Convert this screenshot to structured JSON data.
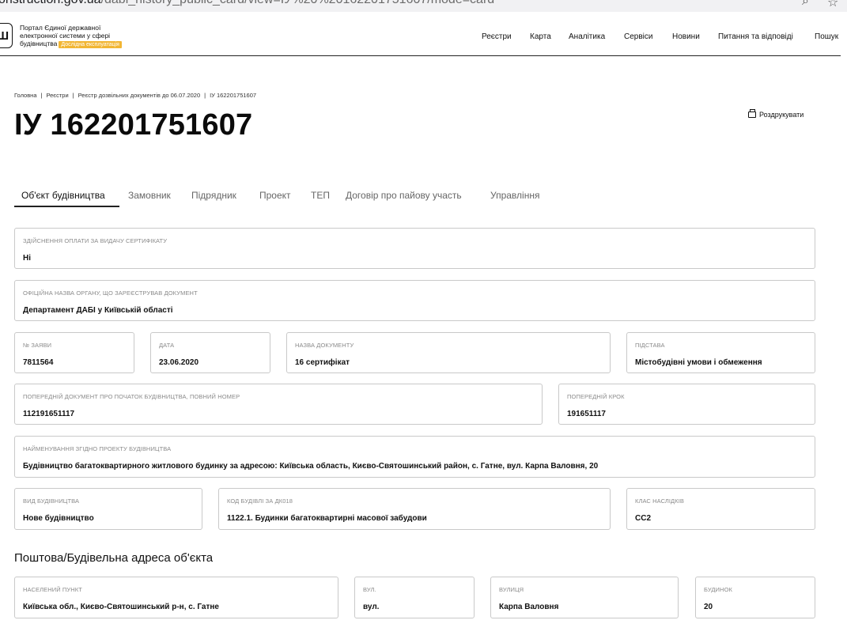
{
  "browser": {
    "url_host": "onstruction.gov.ua",
    "url_path": "/dabi_history_public_card/view=IУ%20%20162201751607/mode=card"
  },
  "header": {
    "brand_line1": "Портал Єдиної державної",
    "brand_line2": "електронної системи у сфері",
    "brand_line3": "будівництва",
    "badge": "Дослідна експлуатація",
    "nav": [
      "Реєстри",
      "Карта",
      "Аналітика",
      "Сервіси",
      "Новини",
      "Питання та відповіді",
      "Пошук"
    ]
  },
  "breadcrumb": [
    "Головна",
    "Реєстри",
    "Реєстр дозвільних документів до 06.07.2020",
    "ІУ 162201751607"
  ],
  "page_title": "ІУ 162201751607",
  "print_label": "Роздрукувати",
  "tabs": [
    "Об'єкт будівництва",
    "Замовник",
    "Підрядник",
    "Проект",
    "ТЕП",
    "Договір про пайову участь",
    "Управління"
  ],
  "fields": {
    "payment": {
      "label": "Здійснення оплати за видачу сертифікату",
      "value": "Ні"
    },
    "authority": {
      "label": "Офіційна назва органу, що зареєстрував документ",
      "value": "Департамент ДАБІ у Київській області"
    },
    "application_no": {
      "label": "№ заяви",
      "value": "7811564"
    },
    "date": {
      "label": "Дата",
      "value": "23.06.2020"
    },
    "doc_name": {
      "label": "Назва документу",
      "value": "16 сертифікат"
    },
    "basis": {
      "label": "Підстава",
      "value": "Містобудівні умови і обмеження"
    },
    "prev_doc": {
      "label": "Попередній документ про початок будівництва, повний номер",
      "value": "112191651117"
    },
    "prev_step": {
      "label": "Попередній крок",
      "value": "191651117"
    },
    "project_name": {
      "label": "Найменування згідно проекту будівництва",
      "value": "Будівництво багатоквартирного житлового будинку за адресою: Київська область, Києво-Святошинський район, с. Гатне, вул. Карпа Валовня, 20"
    },
    "construction_type": {
      "label": "Вид будівництва",
      "value": "Нове будівництво"
    },
    "building_code": {
      "label": "Код будівлі за ДК018",
      "value": "1122.1. Будинки багатоквартирні масової забудови"
    },
    "consequence_class": {
      "label": "Клас наслідків",
      "value": "CC2"
    }
  },
  "address_section_title": "Поштова/Будівельна адреса об'єкта",
  "address": {
    "settlement": {
      "label": "Населений пункт",
      "value": "Київська обл., Києво-Святошинський р-н, с. Гатне"
    },
    "street_type": {
      "label": "Вул.",
      "value": "вул."
    },
    "street": {
      "label": "Вулиця",
      "value": "Карпа Валовня"
    },
    "house": {
      "label": "Будинок",
      "value": "20"
    }
  }
}
